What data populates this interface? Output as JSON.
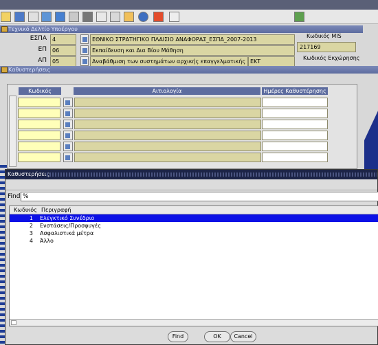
{
  "form_header": {
    "title": "Τεχνικό Δελτίο Υποέργου",
    "fields": [
      {
        "label": "ΕΣΠΑ",
        "code": "4",
        "value": "ΕΘΝΙΚΟ ΣΤΡΑΤΗΓΙΚΟ ΠΛΑΙΣΙΟ ΑΝΑΦΟΡΑΣ_ΕΣΠΑ_2007-2013"
      },
      {
        "label": "ΕΠ",
        "code": "06",
        "value": "Εκπαίδευση και Δια Βίου Μάθηση"
      },
      {
        "label": "ΑΠ",
        "code": "05",
        "value": "Αναβάθμιση των συστημάτων αρχικής επαγγελματικής κατάρτιση",
        "extra": "ΕΚΤ"
      }
    ],
    "mis_label": "Κωδικός MIS",
    "mis_value": "217169",
    "kod_label": "Κωδικός Εκχώρησης"
  },
  "delays_form": {
    "title": "Καθυστερήσεις",
    "columns": {
      "code": "Κωδικός",
      "reason": "Αιτιολογία",
      "days": "Ημέρες Καθυστέρησης"
    }
  },
  "lov_dialog": {
    "title": "Καθυστερήσεις",
    "find_label": "Find",
    "find_value": "%",
    "col_code": "Κωδικός",
    "col_desc": "Περιγραφή",
    "rows": [
      {
        "code": "1",
        "desc": "Ελεγκτικό Συνέδριο"
      },
      {
        "code": "2",
        "desc": "Ενστάσεις/Προσφυγές"
      },
      {
        "code": "3",
        "desc": "Ασφαλιστικά μέτρα"
      },
      {
        "code": "4",
        "desc": "Άλλο"
      }
    ],
    "selected_index": 0,
    "buttons": {
      "find": "Find",
      "ok": "OK",
      "cancel": "Cancel"
    }
  },
  "colors": {
    "selection": "#0b10e6",
    "title_bar": "#1c2447",
    "field_khaki": "#dad6a3",
    "field_yellow": "#ffffb9"
  },
  "toolbar_icons": [
    "save-icon",
    "grid-icon",
    "up-arrow-icon",
    "down-arrow-icon",
    "print-icon",
    "open-icon",
    "edit-icon",
    "copy-icon",
    "paste-icon",
    "help-icon",
    "exit-icon",
    "document-icon",
    "navigate-icon"
  ]
}
